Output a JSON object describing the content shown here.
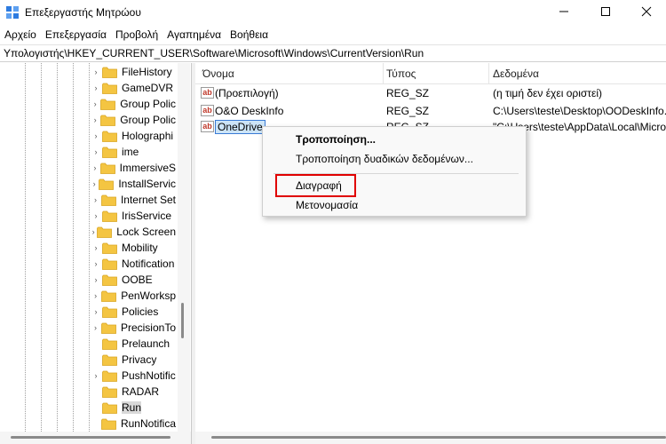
{
  "window": {
    "title": "Επεξεργαστής Μητρώου",
    "buttons": [
      "—",
      "☐",
      "✕"
    ]
  },
  "menu": [
    "Αρχείο",
    "Επεξεργασία",
    "Προβολή",
    "Αγαπημένα",
    "Βοήθεια"
  ],
  "address": "Υπολογιστής\\HKEY_CURRENT_USER\\Software\\Microsoft\\Windows\\CurrentVersion\\Run",
  "tree": {
    "items": [
      {
        "label": "FileHistory",
        "expandable": true
      },
      {
        "label": "GameDVR",
        "expandable": true
      },
      {
        "label": "Group Polic",
        "expandable": true
      },
      {
        "label": "Group Polic",
        "expandable": true
      },
      {
        "label": "Holographi",
        "expandable": true
      },
      {
        "label": "ime",
        "expandable": true
      },
      {
        "label": "ImmersiveS",
        "expandable": true
      },
      {
        "label": "InstallServic",
        "expandable": true
      },
      {
        "label": "Internet Set",
        "expandable": true
      },
      {
        "label": "IrisService",
        "expandable": true
      },
      {
        "label": "Lock Screen",
        "expandable": true
      },
      {
        "label": "Mobility",
        "expandable": true
      },
      {
        "label": "Notification",
        "expandable": true
      },
      {
        "label": "OOBE",
        "expandable": true
      },
      {
        "label": "PenWorksp",
        "expandable": true
      },
      {
        "label": "Policies",
        "expandable": true
      },
      {
        "label": "PrecisionTo",
        "expandable": true
      },
      {
        "label": "Prelaunch",
        "expandable": false
      },
      {
        "label": "Privacy",
        "expandable": false
      },
      {
        "label": "PushNotific",
        "expandable": true
      },
      {
        "label": "RADAR",
        "expandable": false
      },
      {
        "label": "Run",
        "expandable": false,
        "selected": true
      },
      {
        "label": "RunNotifica",
        "expandable": false
      }
    ]
  },
  "list": {
    "columns": [
      "Όνομα",
      "Τύπος",
      "Δεδομένα"
    ],
    "rows": [
      {
        "name": "(Προεπιλογή)",
        "type": "REG_SZ",
        "data": "(η τιμή δεν έχει οριστεί)"
      },
      {
        "name": "O&O DeskInfo",
        "type": "REG_SZ",
        "data": "C:\\Users\\teste\\Desktop\\OODeskInfo."
      },
      {
        "name": "OneDrive",
        "type": "REG_SZ",
        "data": "\"C:\\Users\\teste\\AppData\\Local\\Micro",
        "selected": true
      }
    ]
  },
  "context_menu": {
    "items": [
      {
        "label": "Τροποποίηση...",
        "bold": true
      },
      {
        "label": "Τροποποίηση δυαδικών δεδομένων...",
        "bold": false
      },
      {
        "label": "Διαγραφή",
        "bold": false,
        "highlighted": true
      },
      {
        "label": "Μετονομασία",
        "bold": false
      }
    ],
    "highlight_color": "#e00000"
  },
  "colors": {
    "folder": "#f4c542",
    "selection": "#cce4f7",
    "selection_border": "#3a7bd5"
  }
}
